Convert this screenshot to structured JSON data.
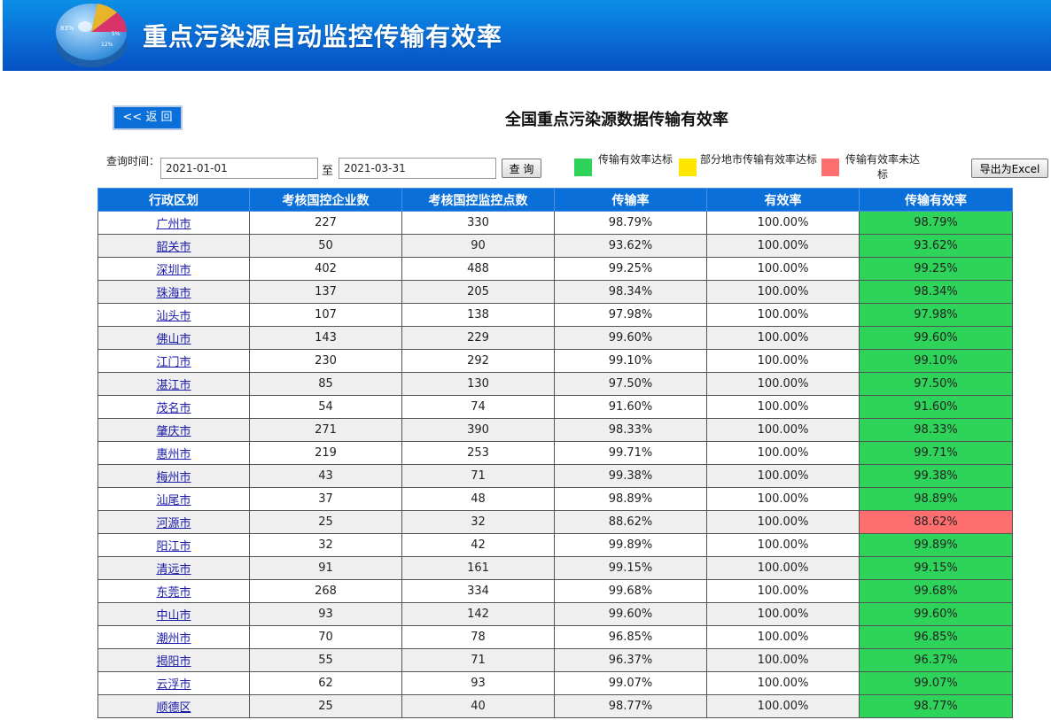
{
  "header": {
    "title": "重点污染源自动监控传输有效率",
    "logo_labels": [
      "83%",
      "5%",
      "12%"
    ]
  },
  "toolbar": {
    "back_label": "<< 返 回",
    "page_title": "全国重点污染源数据传输有效率",
    "query_label": "查询时间：",
    "date_from": "2021-01-01",
    "separator": "至",
    "date_to": "2021-03-31",
    "query_button": "查 询",
    "export_button": "导出为Excel"
  },
  "legend": [
    {
      "label": "传输有效率达标",
      "color": "#2ed35a"
    },
    {
      "label": "部分地市传输有效率达标",
      "color": "#ffe600"
    },
    {
      "label": "传输有效率未达标",
      "color": "#ff6e6e"
    }
  ],
  "table": {
    "columns": [
      "行政区划",
      "考核国控企业数",
      "考核国控监控点数",
      "传输率",
      "有效率",
      "传输有效率"
    ],
    "rows": [
      {
        "city": "广州市",
        "companies": "227",
        "points": "330",
        "trans": "98.79%",
        "valid": "100.00%",
        "eff": "98.79%",
        "status": "green"
      },
      {
        "city": "韶关市",
        "companies": "50",
        "points": "90",
        "trans": "93.62%",
        "valid": "100.00%",
        "eff": "93.62%",
        "status": "green"
      },
      {
        "city": "深圳市",
        "companies": "402",
        "points": "488",
        "trans": "99.25%",
        "valid": "100.00%",
        "eff": "99.25%",
        "status": "green"
      },
      {
        "city": "珠海市",
        "companies": "137",
        "points": "205",
        "trans": "98.34%",
        "valid": "100.00%",
        "eff": "98.34%",
        "status": "green"
      },
      {
        "city": "汕头市",
        "companies": "107",
        "points": "138",
        "trans": "97.98%",
        "valid": "100.00%",
        "eff": "97.98%",
        "status": "green"
      },
      {
        "city": "佛山市",
        "companies": "143",
        "points": "229",
        "trans": "99.60%",
        "valid": "100.00%",
        "eff": "99.60%",
        "status": "green"
      },
      {
        "city": "江门市",
        "companies": "230",
        "points": "292",
        "trans": "99.10%",
        "valid": "100.00%",
        "eff": "99.10%",
        "status": "green"
      },
      {
        "city": "湛江市",
        "companies": "85",
        "points": "130",
        "trans": "97.50%",
        "valid": "100.00%",
        "eff": "97.50%",
        "status": "green"
      },
      {
        "city": "茂名市",
        "companies": "54",
        "points": "74",
        "trans": "91.60%",
        "valid": "100.00%",
        "eff": "91.60%",
        "status": "green"
      },
      {
        "city": "肇庆市",
        "companies": "271",
        "points": "390",
        "trans": "98.33%",
        "valid": "100.00%",
        "eff": "98.33%",
        "status": "green"
      },
      {
        "city": "惠州市",
        "companies": "219",
        "points": "253",
        "trans": "99.71%",
        "valid": "100.00%",
        "eff": "99.71%",
        "status": "green"
      },
      {
        "city": "梅州市",
        "companies": "43",
        "points": "71",
        "trans": "99.38%",
        "valid": "100.00%",
        "eff": "99.38%",
        "status": "green"
      },
      {
        "city": "汕尾市",
        "companies": "37",
        "points": "48",
        "trans": "98.89%",
        "valid": "100.00%",
        "eff": "98.89%",
        "status": "green"
      },
      {
        "city": "河源市",
        "companies": "25",
        "points": "32",
        "trans": "88.62%",
        "valid": "100.00%",
        "eff": "88.62%",
        "status": "red"
      },
      {
        "city": "阳江市",
        "companies": "32",
        "points": "42",
        "trans": "99.89%",
        "valid": "100.00%",
        "eff": "99.89%",
        "status": "green"
      },
      {
        "city": "清远市",
        "companies": "91",
        "points": "161",
        "trans": "99.15%",
        "valid": "100.00%",
        "eff": "99.15%",
        "status": "green"
      },
      {
        "city": "东莞市",
        "companies": "268",
        "points": "334",
        "trans": "99.68%",
        "valid": "100.00%",
        "eff": "99.68%",
        "status": "green"
      },
      {
        "city": "中山市",
        "companies": "93",
        "points": "142",
        "trans": "99.60%",
        "valid": "100.00%",
        "eff": "99.60%",
        "status": "green"
      },
      {
        "city": "潮州市",
        "companies": "70",
        "points": "78",
        "trans": "96.85%",
        "valid": "100.00%",
        "eff": "96.85%",
        "status": "green"
      },
      {
        "city": "揭阳市",
        "companies": "55",
        "points": "71",
        "trans": "96.37%",
        "valid": "100.00%",
        "eff": "96.37%",
        "status": "green"
      },
      {
        "city": "云浮市",
        "companies": "62",
        "points": "93",
        "trans": "99.07%",
        "valid": "100.00%",
        "eff": "99.07%",
        "status": "green"
      },
      {
        "city": "顺德区",
        "companies": "25",
        "points": "40",
        "trans": "98.77%",
        "valid": "100.00%",
        "eff": "98.77%",
        "status": "green"
      }
    ]
  }
}
